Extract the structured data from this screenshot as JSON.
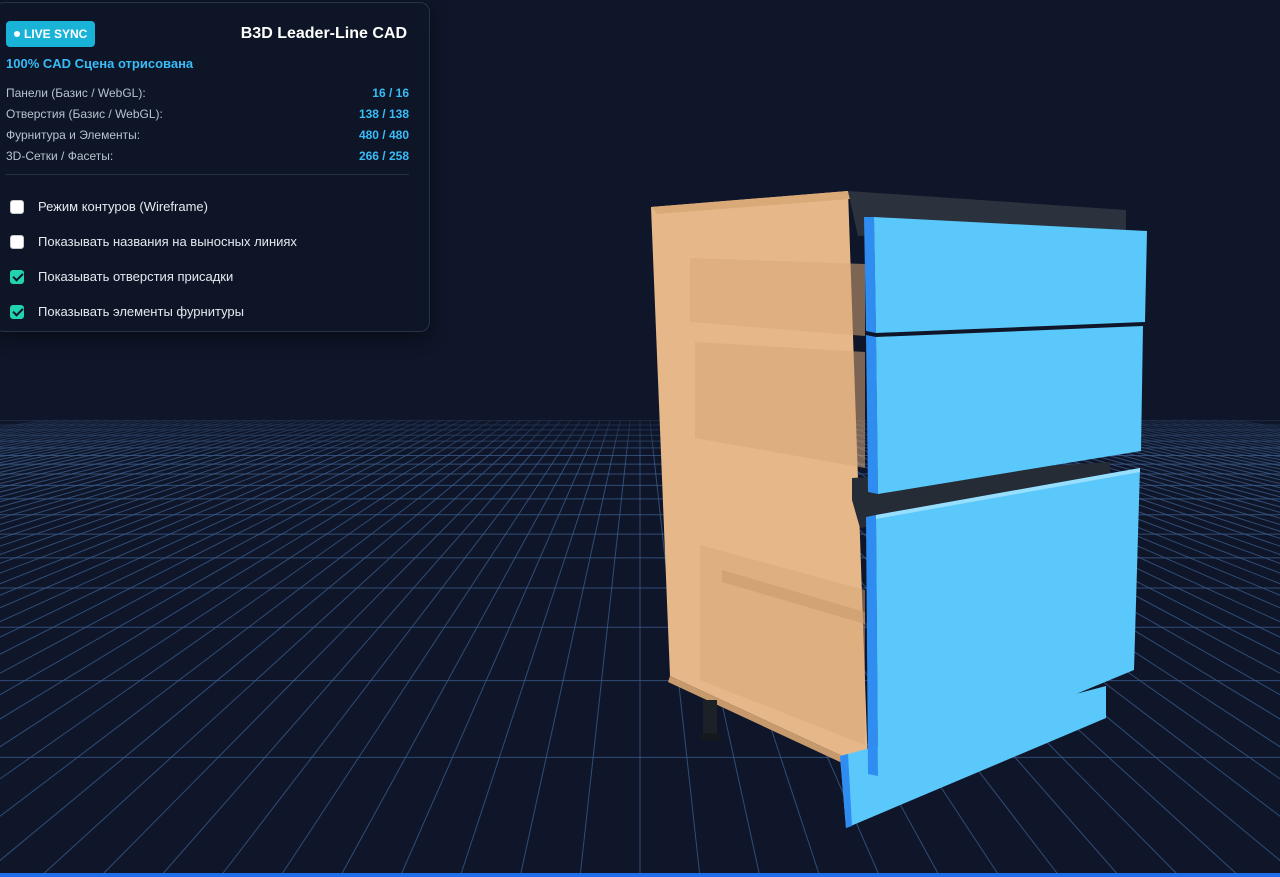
{
  "header": {
    "badge_label": "LIVE SYNC",
    "title": "B3D Leader-Line CAD",
    "status": "100% CAD Сцена отрисована"
  },
  "stats": [
    {
      "label": "Панели (Базис / WebGL):",
      "value": "16 / 16"
    },
    {
      "label": "Отверстия (Базис / WebGL):",
      "value": "138 / 138"
    },
    {
      "label": "Фурнитура и Элементы:",
      "value": "480 / 480"
    },
    {
      "label": "3D-Сетки / Фасеты:",
      "value": "266 / 258"
    }
  ],
  "options": [
    {
      "label": "Режим контуров (Wireframe)",
      "checked": false
    },
    {
      "label": "Показывать названия на выносных линиях",
      "checked": false
    },
    {
      "label": "Показывать отверстия присадки",
      "checked": true
    },
    {
      "label": "Показывать элементы фурнитуры",
      "checked": true
    }
  ],
  "colors": {
    "background": "#0f1629",
    "grid_line": "#3c5f8f",
    "accent": "#38bdf8",
    "badge": "#1ab3d8",
    "checkbox_on": "#22d3b0",
    "carcass": "#e8b98a",
    "facade": "#5ac8fa",
    "facade_edge": "#2f8cf0",
    "countertop_rail": "#2a323c"
  }
}
